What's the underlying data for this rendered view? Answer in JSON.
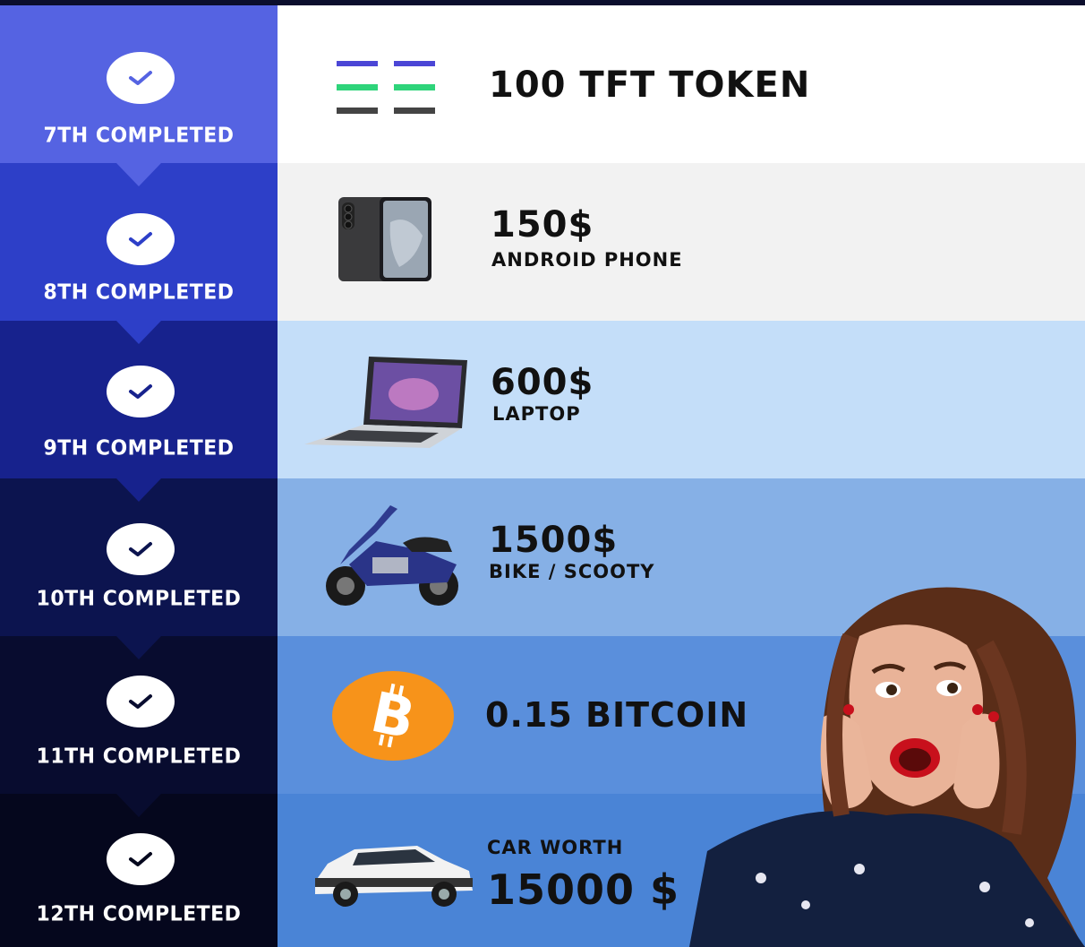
{
  "colors": {
    "row1_left": "#5563e2",
    "row1_right": "#ffffff",
    "row2_left": "#2d3fc8",
    "row2_right": "#f2f2f2",
    "row3_left": "#17228d",
    "row3_right": "#c4def9",
    "row4_left": "#0c144f",
    "row4_right": "#86b0e6",
    "row5_left": "#080c2f",
    "row5_right": "#5a8fdc",
    "row6_left": "#05071d",
    "row6_right": "#4a84d6"
  },
  "rewards": [
    {
      "step": "7TH COMPLETED",
      "title": "100 TFT TOKEN",
      "icon": "tft-token-logo-icon"
    },
    {
      "step": "8TH COMPLETED",
      "title": "150$",
      "subtitle": "ANDROID PHONE",
      "icon": "android-phone-icon"
    },
    {
      "step": "9TH COMPLETED",
      "title": "600$",
      "subtitle": "LAPTOP",
      "icon": "laptop-icon"
    },
    {
      "step": "10TH COMPLETED",
      "title": "1500$",
      "subtitle": "BIKE / SCOOTY",
      "icon": "scooter-icon"
    },
    {
      "step": "11TH COMPLETED",
      "title": "0.15 BITCOIN",
      "icon": "bitcoin-icon"
    },
    {
      "step": "12TH COMPLETED",
      "pretitle": "CAR WORTH",
      "title": "15000 $",
      "icon": "car-icon"
    }
  ]
}
